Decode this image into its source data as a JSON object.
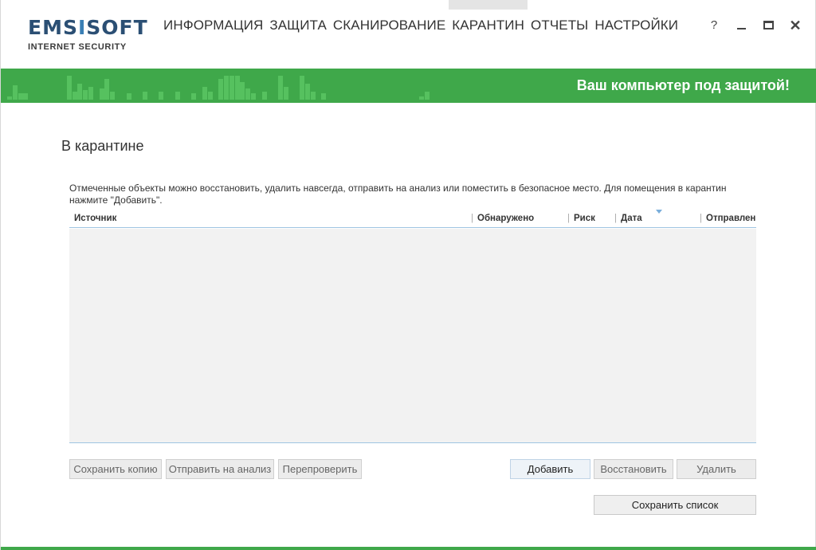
{
  "logo": {
    "brand_a": "EMS",
    "brand_b": "I",
    "brand_c": "SOFT",
    "product": "INTERNET SECURITY"
  },
  "nav": [
    {
      "label": "ИНФОРМАЦИЯ"
    },
    {
      "label": "ЗАЩИТА"
    },
    {
      "label": "СКАНИРОВАНИЕ"
    },
    {
      "label": "КАРАНТИН",
      "active": true
    },
    {
      "label": "ОТЧЕТЫ"
    },
    {
      "label": "НАСТРОЙКИ"
    }
  ],
  "window_controls": {
    "help": "?"
  },
  "status": {
    "text": "Ваш компьютер под защитой!",
    "color": "#3fa84a"
  },
  "page": {
    "title": "В карантине",
    "description": "Отмеченные объекты можно восстановить, удалить навсегда, отправить на анализ или поместить в безопасное место. Для помещения в карантин нажмите \"Добавить\"."
  },
  "table": {
    "columns": [
      "Источник",
      "Обнаружено",
      "Риск",
      "Дата",
      "Отправлен"
    ],
    "rows": []
  },
  "buttons": {
    "save_copy": "Сохранить копию",
    "send_analysis": "Отправить на анализ",
    "rescan": "Перепроверить",
    "add": "Добавить",
    "restore": "Восстановить",
    "delete": "Удалить",
    "save_list": "Сохранить список"
  }
}
